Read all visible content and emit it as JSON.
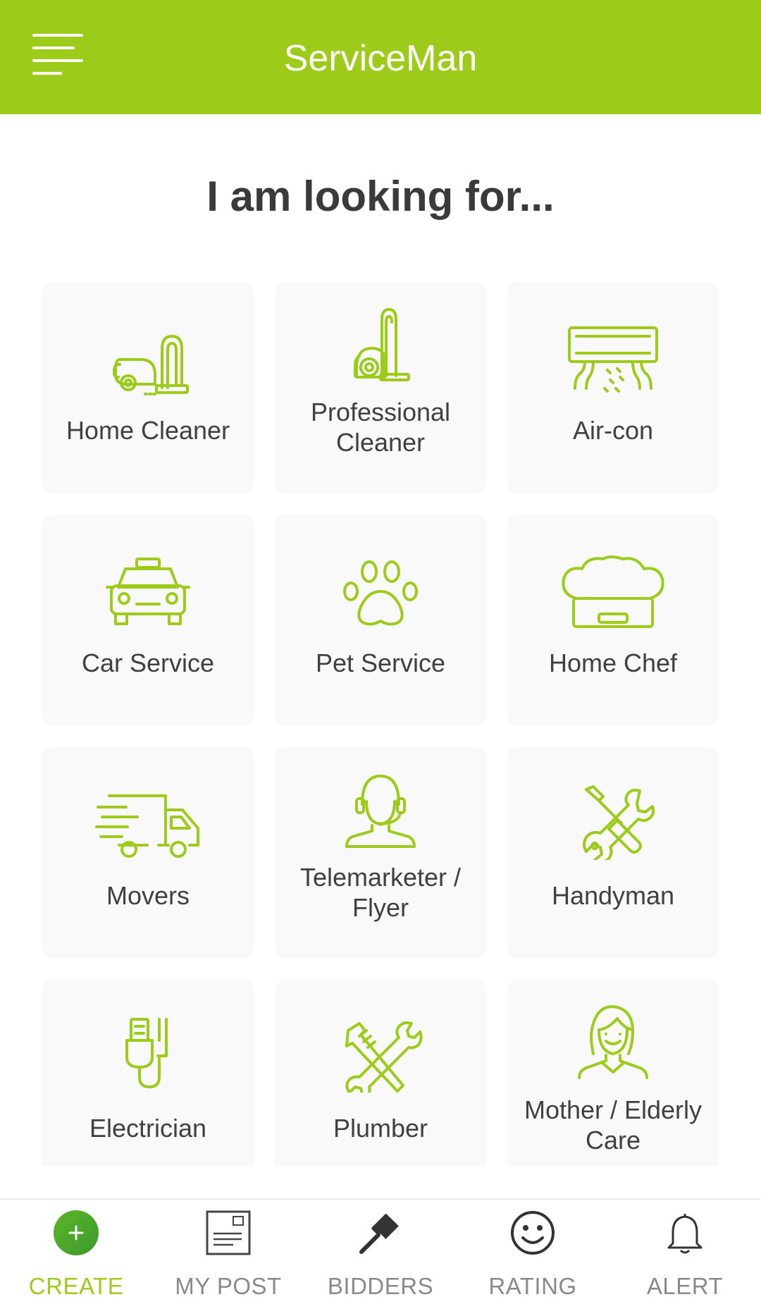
{
  "app": {
    "title": "ServiceMan"
  },
  "header": {
    "menu_icon": "menu-icon"
  },
  "main": {
    "heading": "I am looking for...",
    "categories": [
      {
        "label": "Home Cleaner",
        "icon": "vacuum-cleaner-icon"
      },
      {
        "label": "Professional Cleaner",
        "icon": "canister-vacuum-icon"
      },
      {
        "label": "Air-con",
        "icon": "air-conditioner-icon"
      },
      {
        "label": "Car Service",
        "icon": "taxi-icon"
      },
      {
        "label": "Pet Service",
        "icon": "paw-icon"
      },
      {
        "label": "Home Chef",
        "icon": "chef-hat-icon"
      },
      {
        "label": "Movers",
        "icon": "moving-truck-icon"
      },
      {
        "label": "Telemarketer / Flyer",
        "icon": "headset-operator-icon"
      },
      {
        "label": "Handyman",
        "icon": "wrench-screwdriver-icon"
      },
      {
        "label": "Electrician",
        "icon": "electric-plug-icon"
      },
      {
        "label": "Plumber",
        "icon": "pipe-wrench-icon"
      },
      {
        "label": "Mother / Elderly Care",
        "icon": "woman-icon"
      }
    ]
  },
  "bottom_nav": {
    "items": [
      {
        "label": "CREATE",
        "icon": "plus-circle-icon",
        "active": true
      },
      {
        "label": "MY POST",
        "icon": "post-icon",
        "active": false
      },
      {
        "label": "BIDDERS",
        "icon": "gavel-icon",
        "active": false
      },
      {
        "label": "RATING",
        "icon": "smiley-icon",
        "active": false
      },
      {
        "label": "ALERT",
        "icon": "bell-icon",
        "active": false
      }
    ]
  },
  "colors": {
    "brand": "#9ccb19",
    "text": "#404040",
    "card_bg": "#f9f9f9",
    "nav_inactive": "#8a8a8a"
  }
}
